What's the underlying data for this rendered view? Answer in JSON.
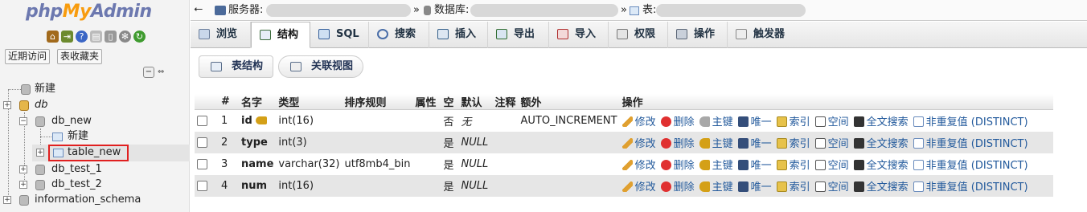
{
  "nav": {
    "logo": {
      "php": "php",
      "my": "My",
      "admin": "Admin"
    },
    "buttons": {
      "recent": "近期访问",
      "favorites": "表收藏夹"
    },
    "tree": {
      "new_top": "新建",
      "db": "db",
      "db_new": "db_new",
      "db_new_create": "新建",
      "table_new": "table_new",
      "db_test_1": "db_test_1",
      "db_test_2": "db_test_2",
      "information_schema": "information_schema"
    }
  },
  "breadcrumb": {
    "server": "服务器:",
    "database": "数据库:",
    "table": "表:",
    "separator": "»"
  },
  "tabs": [
    "浏览",
    "结构",
    "SQL",
    "搜索",
    "插入",
    "导出",
    "导入",
    "权限",
    "操作",
    "触发器"
  ],
  "active_tab": "结构",
  "subtabs": {
    "structure": "表结构",
    "relation_view": "关联视图"
  },
  "table": {
    "headers": {
      "num": "#",
      "name": "名字",
      "type": "类型",
      "collation": "排序规则",
      "attributes": "属性",
      "null": "空",
      "default": "默认",
      "comment": "注释",
      "extra": "额外",
      "action": "操作"
    },
    "actions": {
      "change": "修改",
      "drop": "删除",
      "primary": "主键",
      "unique": "唯一",
      "index": "索引",
      "spatial": "空间",
      "fulltext": "全文搜索",
      "distinct": "非重复值 (DISTINCT)"
    },
    "rows": [
      {
        "num": "1",
        "name": "id",
        "type": "int(16)",
        "collation": "",
        "attributes": "",
        "null": "否",
        "default": "无",
        "comment": "",
        "extra": "AUTO_INCREMENT",
        "primary_key": true
      },
      {
        "num": "2",
        "name": "type",
        "type": "int(3)",
        "collation": "",
        "attributes": "",
        "null": "是",
        "default": "NULL",
        "comment": "",
        "extra": "",
        "primary_key": false
      },
      {
        "num": "3",
        "name": "name",
        "type": "varchar(32)",
        "collation": "utf8mb4_bin",
        "attributes": "",
        "null": "是",
        "default": "NULL",
        "comment": "",
        "extra": "",
        "primary_key": false
      },
      {
        "num": "4",
        "name": "num",
        "type": "int(16)",
        "collation": "",
        "attributes": "",
        "null": "是",
        "default": "NULL",
        "comment": "",
        "extra": "",
        "primary_key": false
      }
    ]
  },
  "colors": {
    "logo_blue": "#6c78af",
    "logo_orange": "#f89c0e",
    "link": "#235a9c",
    "highlight_border": "#e02020"
  }
}
